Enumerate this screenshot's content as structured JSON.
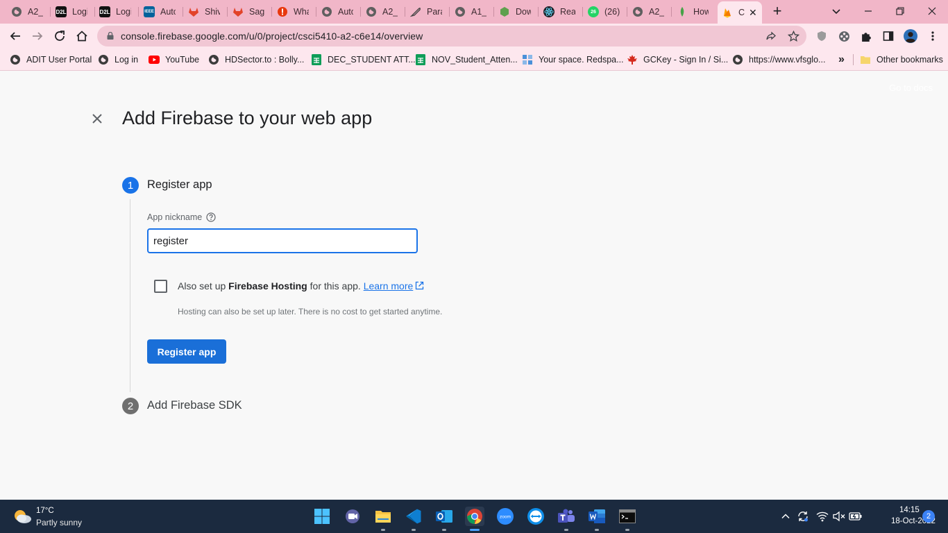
{
  "browser": {
    "tabs": [
      {
        "title": "A2_F",
        "icon": "generic-globe-icon"
      },
      {
        "title": "Logi",
        "icon": "d2l-icon"
      },
      {
        "title": "Logi",
        "icon": "d2l-icon"
      },
      {
        "title": "Autc",
        "icon": "ieee-icon"
      },
      {
        "title": "Shiv",
        "icon": "gitlab-icon"
      },
      {
        "title": "Saga",
        "icon": "gitlab-icon"
      },
      {
        "title": "Wha",
        "icon": "alert-icon"
      },
      {
        "title": "Autc",
        "icon": "generic-globe-icon"
      },
      {
        "title": "A2_C",
        "icon": "generic-globe-icon"
      },
      {
        "title": "Para",
        "icon": "feather-icon"
      },
      {
        "title": "A1_E",
        "icon": "generic-globe-icon"
      },
      {
        "title": "Dow",
        "icon": "nodejs-icon"
      },
      {
        "title": "Reac",
        "icon": "react-icon"
      },
      {
        "title": "(26)",
        "icon": "whatsapp-icon"
      },
      {
        "title": "A2_F",
        "icon": "generic-globe-icon"
      },
      {
        "title": "How",
        "icon": "mongodb-icon"
      },
      {
        "title": "C",
        "icon": "firebase-icon",
        "active": true
      }
    ],
    "badge_26": "26",
    "d2l_label": "D2L",
    "ieee_label": "IEEE",
    "url": "console.firebase.google.com/u/0/project/csci5410-a2-c6e14/overview",
    "bookmarks": [
      {
        "label": "ADIT User Portal",
        "icon": "generic-globe-icon"
      },
      {
        "label": "Log in",
        "icon": "generic-globe-icon"
      },
      {
        "label": "YouTube",
        "icon": "youtube-icon"
      },
      {
        "label": "HDSector.to : Bolly...",
        "icon": "generic-globe-icon"
      },
      {
        "label": "DEC_STUDENT ATT...",
        "icon": "sheets-icon"
      },
      {
        "label": "NOV_Student_Atten...",
        "icon": "sheets-icon"
      },
      {
        "label": "Your space. Redspa...",
        "icon": "redspace-icon"
      },
      {
        "label": "GCKey - Sign In / Si...",
        "icon": "maple-leaf-icon"
      },
      {
        "label": "https://www.vfsglo...",
        "icon": "generic-globe-icon"
      }
    ],
    "more_bookmarks": "»",
    "other_bookmarks": "Other bookmarks"
  },
  "page": {
    "goto_docs": "Go to docs",
    "title": "Add Firebase to your web app",
    "step1": {
      "number": "1",
      "label": "Register app"
    },
    "nickname_label": "App nickname",
    "nickname_value": "register",
    "hosting_prefix": "Also set up ",
    "hosting_bold": "Firebase Hosting",
    "hosting_suffix": " for this app. ",
    "learn_more": "Learn more",
    "hosting_sub": "Hosting can also be set up later. There is no cost to get started anytime.",
    "register_button": "Register app",
    "step2": {
      "number": "2",
      "label": "Add Firebase SDK"
    }
  },
  "taskbar": {
    "weather_temp": "17°C",
    "weather_desc": "Partly sunny",
    "zoom_label": "zoom",
    "time": "14:15",
    "date": "18-Oct-2022",
    "notifications": "2"
  },
  "colors": {
    "accent": "#1a73e8",
    "tab_strip": "#f1b6c8",
    "toolbar": "#fde7ee",
    "taskbar": "#1b2a3f"
  }
}
